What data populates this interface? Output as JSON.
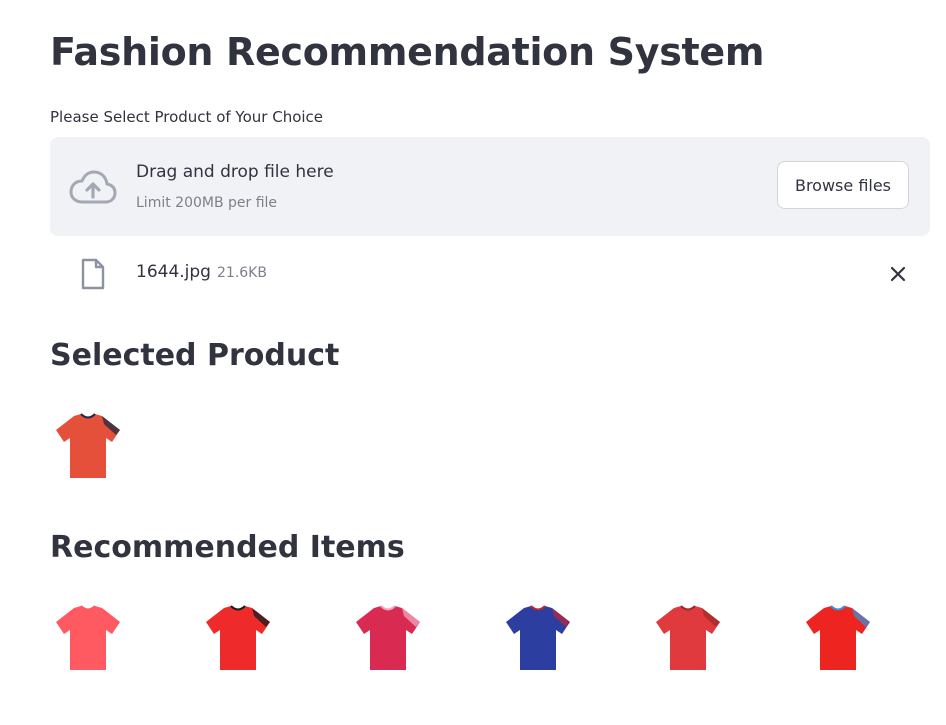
{
  "page": {
    "title": "Fashion Recommendation System",
    "uploader": {
      "label": "Please Select Product of Your Choice",
      "drop_text": "Drag and drop file here",
      "limit_text": "Limit 200MB per file",
      "browse_label": "Browse files",
      "icon": "cloud-upload-icon"
    },
    "uploaded_file": {
      "name": "1644.jpg",
      "size": "21.6KB",
      "icon": "file-icon",
      "remove_icon": "close-icon"
    },
    "selected_section": {
      "heading": "Selected Product",
      "product": {
        "color": "#e4503a",
        "accent": "#1f2a44"
      }
    },
    "recommended_section": {
      "heading": "Recommended Items",
      "items": [
        {
          "color": "#ff5a62",
          "accent": "#ff5a62"
        },
        {
          "color": "#ee2a2a",
          "accent": "#1b1b1b"
        },
        {
          "color": "#d92a52",
          "accent": "#f1a8bc"
        },
        {
          "color": "#2c3fa0",
          "accent": "#b8273a"
        },
        {
          "color": "#e03a3e",
          "accent": "#a12a2a"
        },
        {
          "color": "#ee2420",
          "accent": "#3c8ed6"
        }
      ]
    }
  }
}
